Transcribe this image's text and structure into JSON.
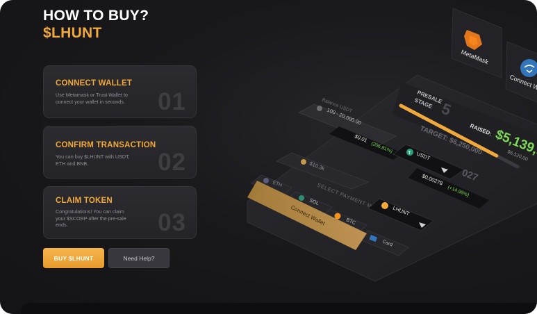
{
  "header": {
    "title": "HOW TO BUY?",
    "subtitle": "$LHUNT"
  },
  "steps": [
    {
      "label": "CONNECT WALLET",
      "desc_lines": [
        "Use Metamask or Trust Wallet to",
        "connect your wallet in seconds."
      ],
      "num": "01"
    },
    {
      "label": "CONFIRM TRANSACTION",
      "desc_lines": [
        "You can buy $LHUNT with USDT,",
        "ETH and BNB."
      ],
      "num": "02"
    },
    {
      "label": "CLAIM TOKEN",
      "desc_lines": [
        "Congratulations! You can claim",
        "your $SCORP after the pre-sale",
        "ends."
      ],
      "num": "03"
    }
  ],
  "buttons": {
    "buy": "BUY $LHUNT",
    "help": "Need Help?"
  },
  "illustration": {
    "wallets": {
      "metamask": "MetaMask",
      "connect": "Connect W"
    },
    "presale": {
      "stage_label": "PRESALE\nSTAGE",
      "stage_num": "5",
      "raised_label": "RAISED:",
      "raised_value": "$5,139,9",
      "raised_sub": "$6,520,00",
      "target": "TARGET: $6,250,000",
      "stage_progress": 0.82
    },
    "balance": {
      "label": "Balance USDT",
      "range": "100 - 20,000.00",
      "price": "$0.01",
      "change": "(206.81%)"
    },
    "usdt": {
      "label": "USDT",
      "price_fragment": "027"
    },
    "lhunt": {
      "price": "$0.00278",
      "change": "(+14.98%)",
      "label": "LHUNT"
    },
    "amount_label": "$10.3k",
    "payment": {
      "title": "SELECT PAYMENT METHOD",
      "methods": [
        "ETH",
        "SOL",
        "BTC",
        "Card"
      ],
      "connect": "Connect Wallet"
    },
    "colors": {
      "accent": "#f2a93b",
      "green": "#7ed957",
      "usdt": "#26a17b",
      "blue": "#3375bb"
    }
  }
}
